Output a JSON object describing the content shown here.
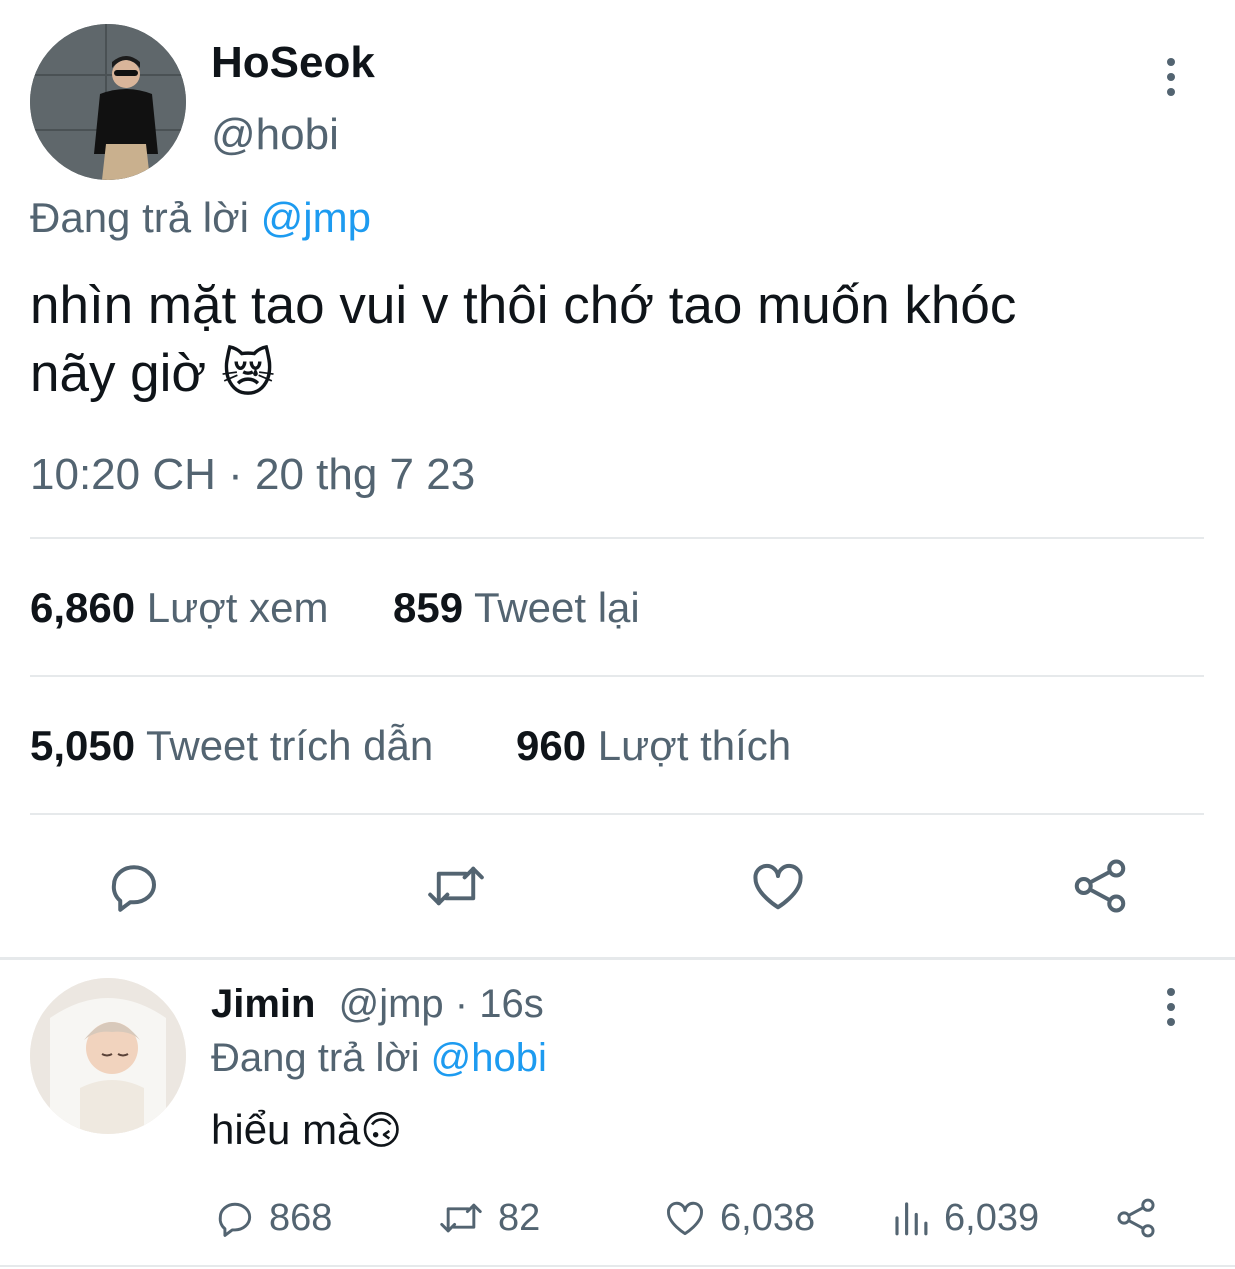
{
  "main_tweet": {
    "author": {
      "display_name": "HoSeok",
      "handle": "@hobi"
    },
    "reply_prefix": "Đang trả lời",
    "reply_to": "@jmp",
    "text_line1": "nhìn mặt tao vui v thôi chớ tao muốn khóc",
    "text_line2": "nãy giờ",
    "emoji": "😿",
    "timestamp": "10:20 CH · 20 thg 7 23",
    "stats": {
      "views": {
        "value": "6,860",
        "label": "Lượt xem"
      },
      "retweets": {
        "value": "859",
        "label": "Tweet lại"
      },
      "quotes": {
        "value": "5,050",
        "label": "Tweet trích dẫn"
      },
      "likes": {
        "value": "960",
        "label": "Lượt thích"
      }
    }
  },
  "reply_tweet": {
    "author": {
      "display_name": "Jimin",
      "handle": "@jmp",
      "time": "· 16s"
    },
    "reply_prefix": "Đang trả lời",
    "reply_to": "@hobi",
    "text": "hiểu mà",
    "emoji": "🙃",
    "counts": {
      "replies": "868",
      "retweets": "82",
      "likes": "6,038",
      "views": "6,039"
    }
  },
  "icons": {
    "more": "more-vertical-icon",
    "reply": "reply-bubble-icon",
    "retweet": "retweet-icon",
    "like": "heart-icon",
    "share": "share-icon",
    "views": "views-chart-icon"
  },
  "colors": {
    "accent": "#1d9bf0",
    "muted": "#536471",
    "text": "#0f1419",
    "divider": "#e6e9eb"
  }
}
